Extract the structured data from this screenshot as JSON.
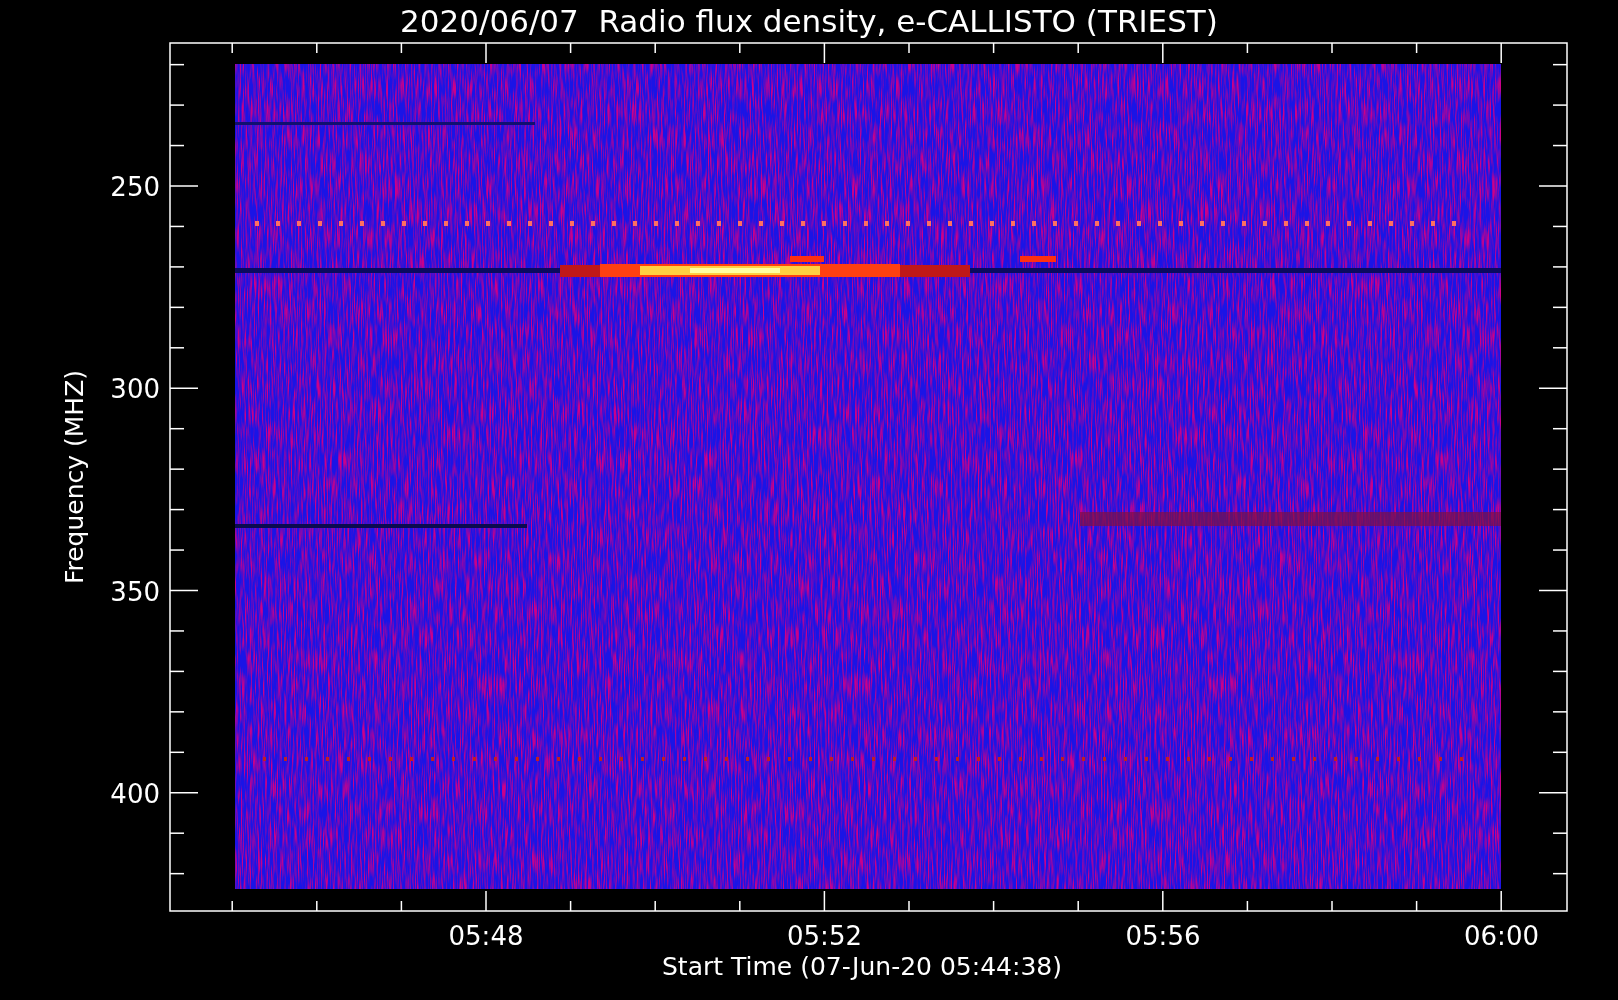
{
  "title": "2020/06/07  Radio flux density, e-CALLISTO (TRIEST)",
  "y_axis": {
    "label": "Frequency (MHZ)",
    "ticks": [
      "250",
      "300",
      "350",
      "400"
    ]
  },
  "x_axis": {
    "label": "Start Time (07-Jun-20 05:44:38)",
    "ticks": [
      "05:48",
      "05:52",
      "05:56",
      "06:00"
    ]
  }
}
